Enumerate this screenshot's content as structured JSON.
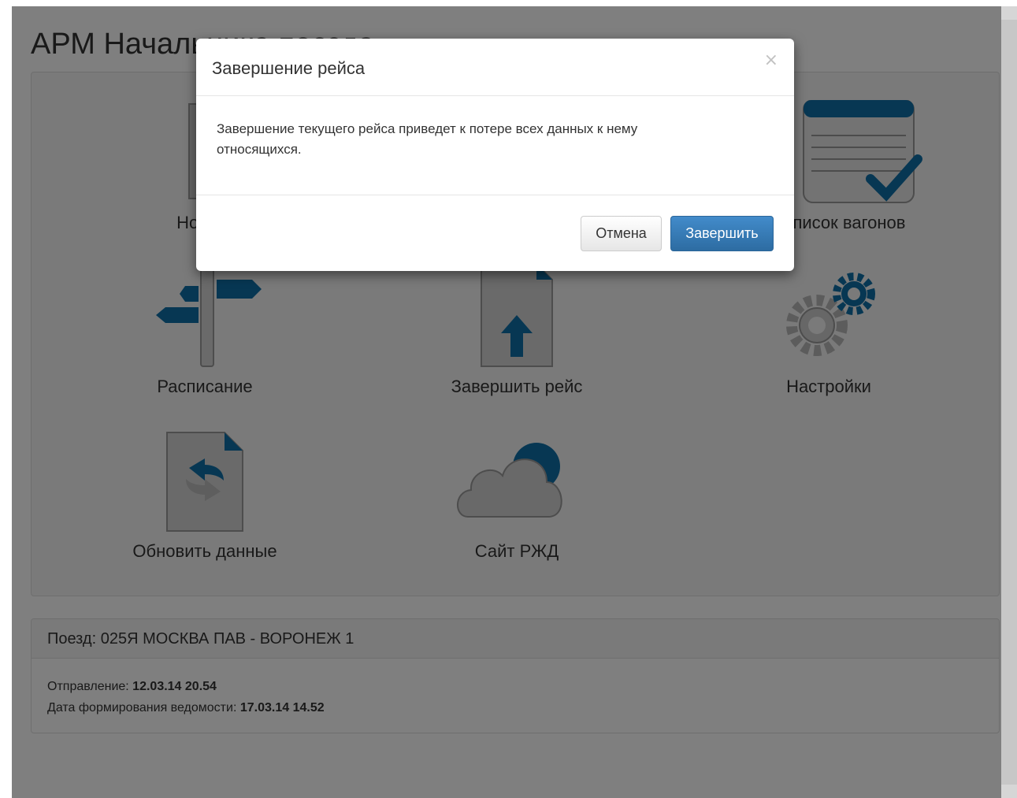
{
  "page": {
    "title": "АРМ Начальника поезда"
  },
  "tiles": [
    {
      "label": "Новый рейс",
      "icon": "document-download-icon"
    },
    {
      "label": "Список вагонов",
      "icon": "list-check-icon"
    },
    {
      "label": "Расписание",
      "icon": "signpost-icon"
    },
    {
      "label": "Завершить рейс",
      "icon": "document-upload-icon"
    },
    {
      "label": "Настройки",
      "icon": "gears-icon"
    },
    {
      "label": "Обновить данные",
      "icon": "document-refresh-icon"
    },
    {
      "label": "Сайт РЖД",
      "icon": "cloud-icon"
    }
  ],
  "info": {
    "train_label": "Поезд: 025Я МОСКВА ПАВ - ВОРОНЕЖ 1",
    "departure_label": "Отправление:",
    "departure_value": "12.03.14 20.54",
    "report_date_label": "Дата формирования ведомости:",
    "report_date_value": "17.03.14 14.52"
  },
  "modal": {
    "title": "Завершение рейса",
    "close_glyph": "×",
    "body": "Завершение текущего рейса приведет к потере всех данных к нему относящихся.",
    "cancel_label": "Отмена",
    "confirm_label": "Завершить"
  },
  "colors": {
    "accent_blue": "#0e6fa7",
    "icon_gray": "#c8c8c8",
    "primary_button": "#337ab7"
  }
}
